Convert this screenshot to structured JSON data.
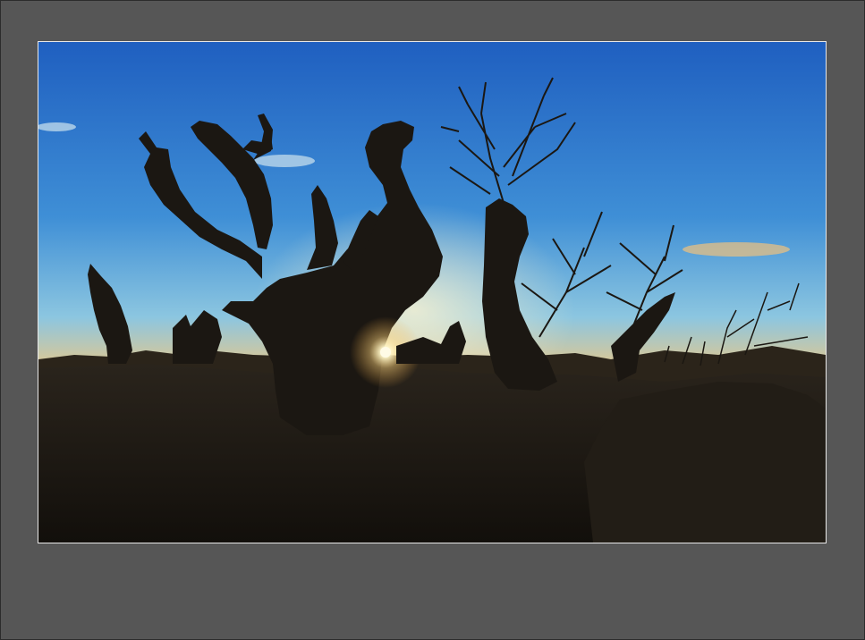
{
  "image": {
    "subject": "photo",
    "colors": {
      "mat": "#565656",
      "photo_border": "#e8e8e8",
      "sky_top": "#1f5fc0",
      "sky_mid": "#4f9ed8",
      "horizon": "#f7a43a",
      "sun": "#fffbe6",
      "silhouette": "#1b1712"
    }
  }
}
